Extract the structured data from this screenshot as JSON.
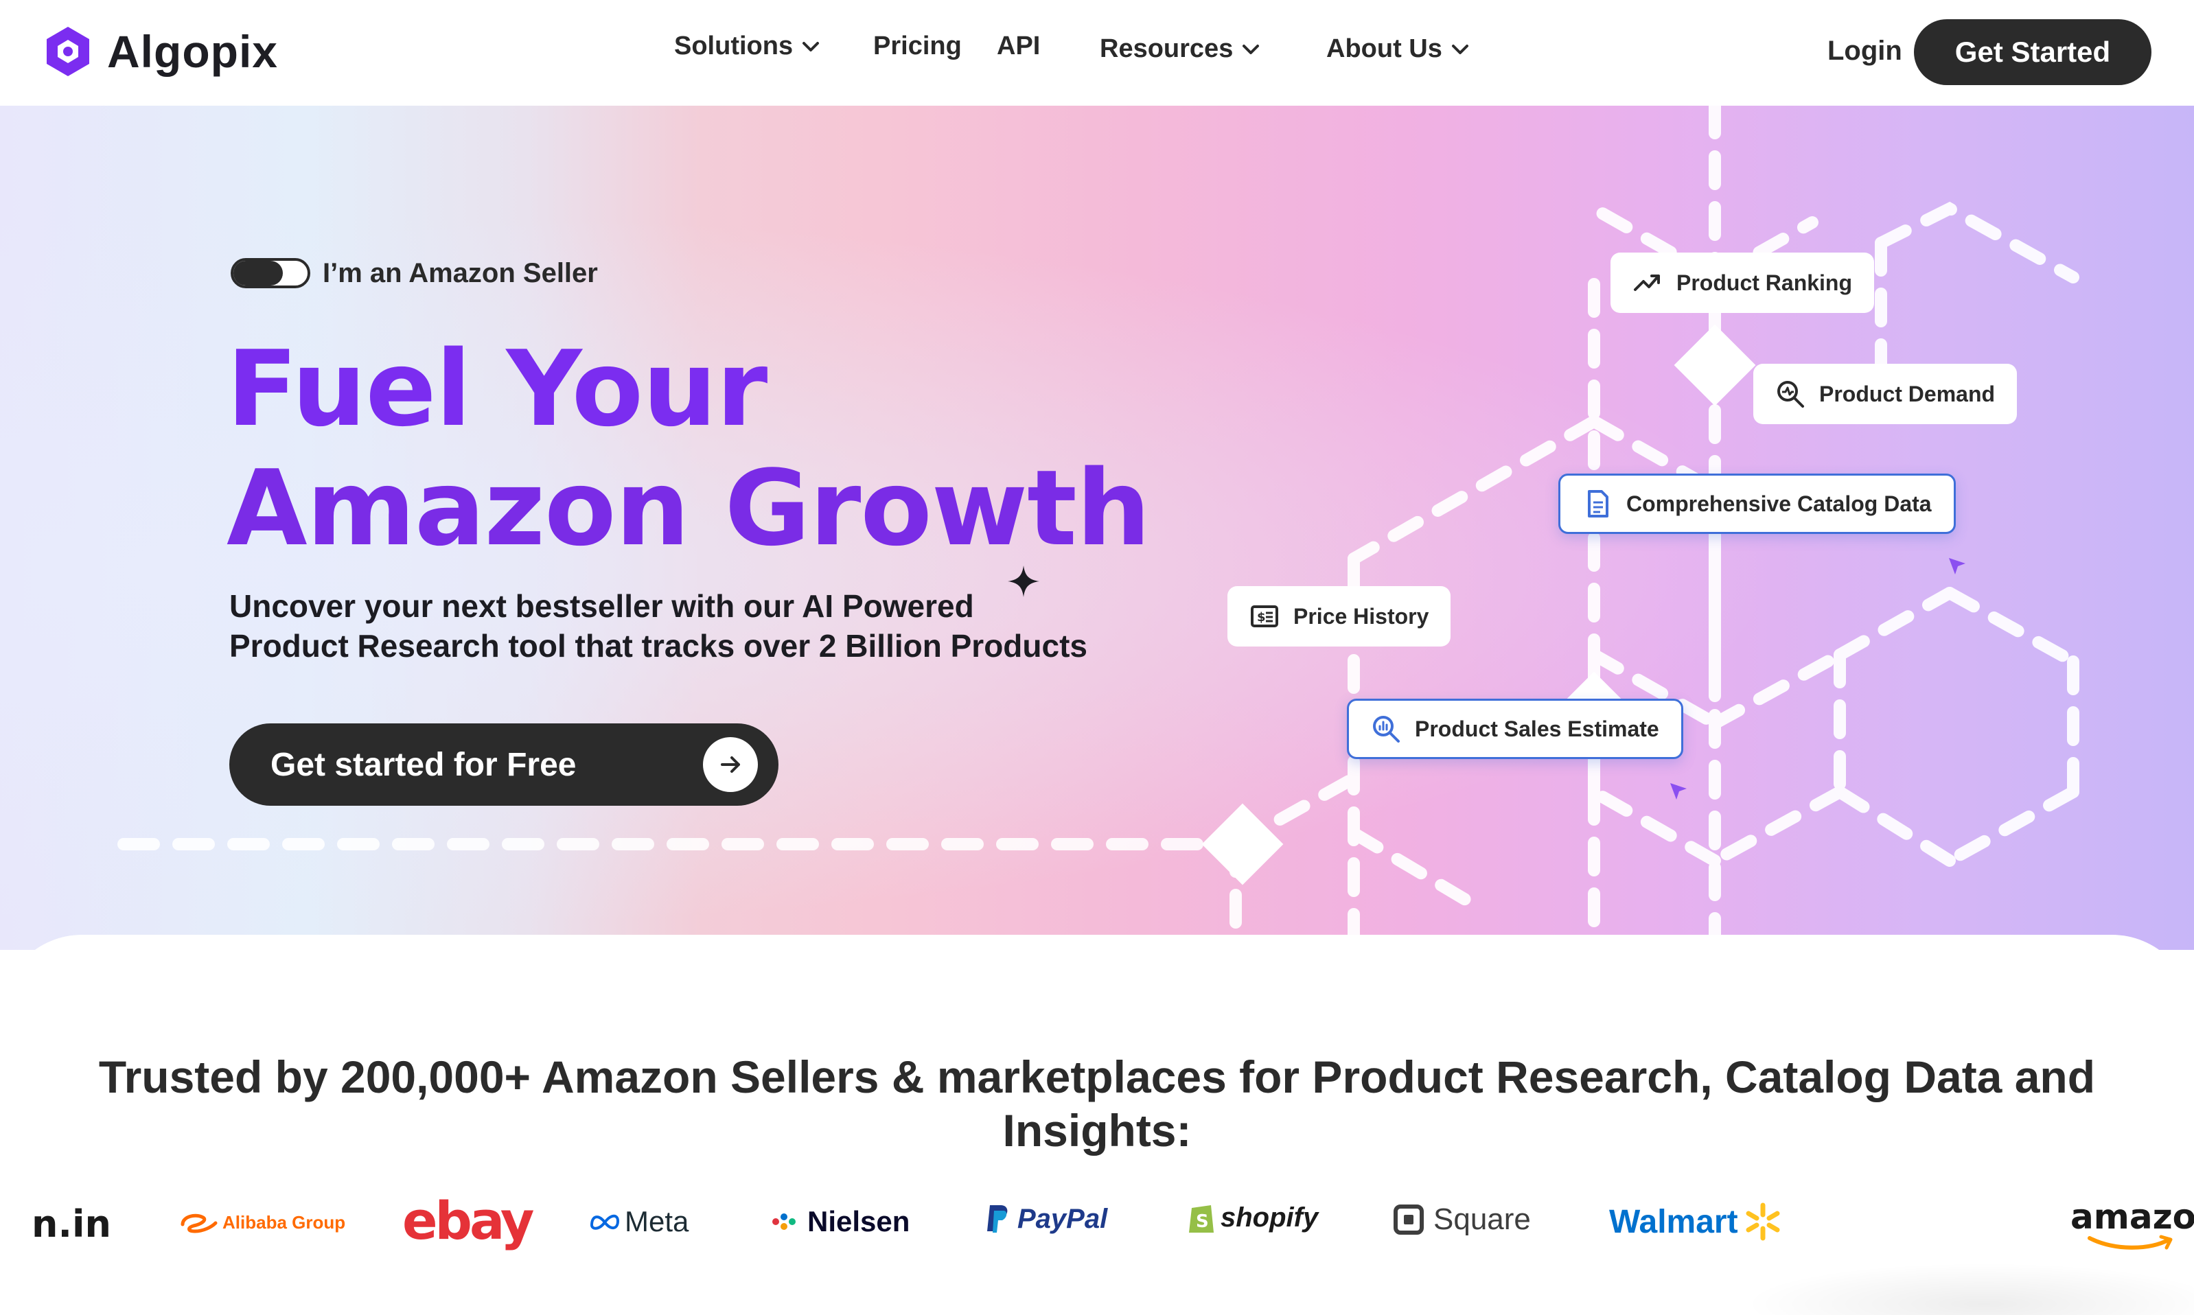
{
  "brand": {
    "name": "Algopix",
    "accent": "#7b2df0"
  },
  "nav": {
    "items": [
      {
        "label": "Solutions",
        "has_dropdown": true
      },
      {
        "label": "Pricing",
        "has_dropdown": false
      },
      {
        "label": "API",
        "has_dropdown": false
      },
      {
        "label": "Resources",
        "has_dropdown": true
      },
      {
        "label": "About Us",
        "has_dropdown": true
      }
    ],
    "login": "Login",
    "cta": "Get Started"
  },
  "hero": {
    "toggle_label": "I’m an Amazon Seller",
    "toggle_on": true,
    "headline_line1": "Fuel Your",
    "headline_line2": "Amazon Growth",
    "subtitle_line1": "Uncover your next bestseller with our AI Powered",
    "subtitle_line2": "Product Research tool that tracks over 2 Billion Products",
    "cta": "Get started for Free",
    "features": [
      {
        "label": "Product Ranking",
        "icon": "trend-up-icon"
      },
      {
        "label": "Product Demand",
        "icon": "demand-search-icon"
      },
      {
        "label": "Comprehensive Catalog Data",
        "icon": "document-icon"
      },
      {
        "label": "Price History",
        "icon": "price-tag-icon"
      },
      {
        "label": "Product Sales Estimate",
        "icon": "sales-search-icon"
      }
    ]
  },
  "trust": {
    "heading_line1": "Trusted by 200,000+ Amazon Sellers & marketplaces for Product Research, Catalog Data and",
    "heading_line2": "Insights:",
    "logos": [
      {
        "text": "n.in",
        "color": "#1a1a1a"
      },
      {
        "text": "Alibaba Group",
        "color": "#ff6a00"
      },
      {
        "text": "ebay",
        "color": "#e53238"
      },
      {
        "text": "Meta",
        "color": "#1c2b33"
      },
      {
        "text": "Nielsen",
        "color": "#0a0a2a"
      },
      {
        "text": "PayPal",
        "color": "#1e3a8a"
      },
      {
        "text": "shopify",
        "color": "#1a1a1a"
      },
      {
        "text": "Square",
        "color": "#3e3e3e"
      },
      {
        "text": "Walmart",
        "color": "#0071ce"
      },
      {
        "text": "amazon",
        "color": "#1a1a1a"
      }
    ]
  }
}
